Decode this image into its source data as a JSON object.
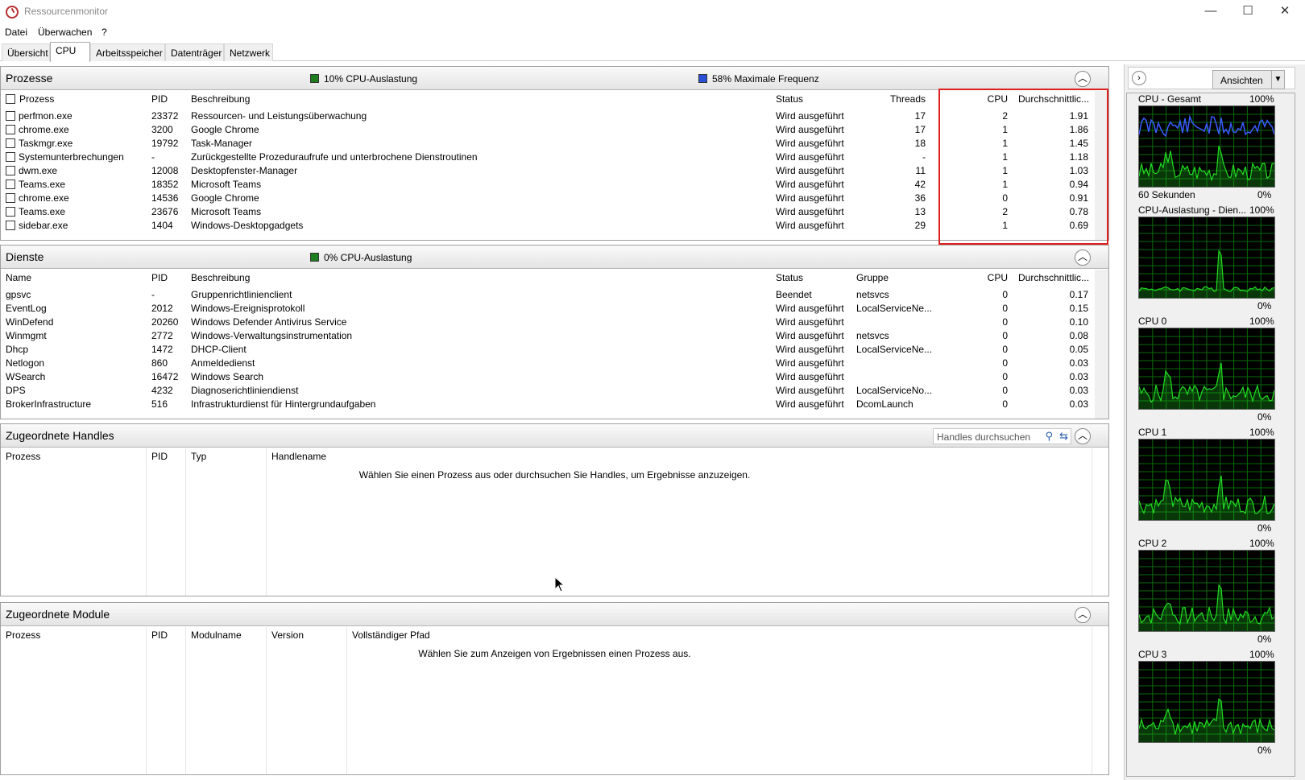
{
  "window": {
    "title": "Ressourcenmonitor",
    "minimize": "—",
    "maximize": "☐",
    "close": "✕"
  },
  "menu": [
    "Datei",
    "Überwachen",
    "?"
  ],
  "tabs": [
    "Übersicht",
    "CPU",
    "Arbeitsspeicher",
    "Datenträger",
    "Netzwerk"
  ],
  "active_tab": "CPU",
  "processes": {
    "title": "Prozesse",
    "cpu_usage": "10% CPU-Auslastung",
    "max_freq": "58% Maximale Frequenz",
    "usage_color": "#1e7d1e",
    "freq_color": "#2a50d8",
    "columns": [
      "Prozess",
      "PID",
      "Beschreibung",
      "Status",
      "Threads",
      "CPU",
      "Durchschnittlic..."
    ],
    "rows": [
      [
        "perfmon.exe",
        "23372",
        "Ressourcen- und Leistungsüberwachung",
        "Wird ausgeführt",
        "17",
        "2",
        "1.91"
      ],
      [
        "chrome.exe",
        "3200",
        "Google Chrome",
        "Wird ausgeführt",
        "17",
        "1",
        "1.86"
      ],
      [
        "Taskmgr.exe",
        "19792",
        "Task-Manager",
        "Wird ausgeführt",
        "18",
        "1",
        "1.45"
      ],
      [
        "Systemunterbrechungen",
        "-",
        "Zurückgestellte Prozeduraufrufe und unterbrochene Dienstroutinen",
        "Wird ausgeführt",
        "-",
        "1",
        "1.18"
      ],
      [
        "dwm.exe",
        "12008",
        "Desktopfenster-Manager",
        "Wird ausgeführt",
        "11",
        "1",
        "1.03"
      ],
      [
        "Teams.exe",
        "18352",
        "Microsoft Teams",
        "Wird ausgeführt",
        "42",
        "1",
        "0.94"
      ],
      [
        "chrome.exe",
        "14536",
        "Google Chrome",
        "Wird ausgeführt",
        "36",
        "0",
        "0.91"
      ],
      [
        "Teams.exe",
        "23676",
        "Microsoft Teams",
        "Wird ausgeführt",
        "13",
        "2",
        "0.78"
      ],
      [
        "sidebar.exe",
        "1404",
        "Windows-Desktopgadgets",
        "Wird ausgeführt",
        "29",
        "1",
        "0.69"
      ]
    ]
  },
  "services": {
    "title": "Dienste",
    "cpu_usage": "0% CPU-Auslastung",
    "columns": [
      "Name",
      "PID",
      "Beschreibung",
      "Status",
      "Gruppe",
      "CPU",
      "Durchschnittlic..."
    ],
    "rows": [
      [
        "gpsvc",
        "-",
        "Gruppenrichtlinienclient",
        "Beendet",
        "netsvcs",
        "0",
        "0.17"
      ],
      [
        "EventLog",
        "2012",
        "Windows-Ereignisprotokoll",
        "Wird ausgeführt",
        "LocalServiceNe...",
        "0",
        "0.15"
      ],
      [
        "WinDefend",
        "20260",
        "Windows Defender Antivirus Service",
        "Wird ausgeführt",
        "",
        "0",
        "0.10"
      ],
      [
        "Winmgmt",
        "2772",
        "Windows-Verwaltungsinstrumentation",
        "Wird ausgeführt",
        "netsvcs",
        "0",
        "0.08"
      ],
      [
        "Dhcp",
        "1472",
        "DHCP-Client",
        "Wird ausgeführt",
        "LocalServiceNe...",
        "0",
        "0.05"
      ],
      [
        "Netlogon",
        "860",
        "Anmeldedienst",
        "Wird ausgeführt",
        "",
        "0",
        "0.03"
      ],
      [
        "WSearch",
        "16472",
        "Windows Search",
        "Wird ausgeführt",
        "",
        "0",
        "0.03"
      ],
      [
        "DPS",
        "4232",
        "Diagnoserichtliniendienst",
        "Wird ausgeführt",
        "LocalServiceNo...",
        "0",
        "0.03"
      ],
      [
        "BrokerInfrastructure",
        "516",
        "Infrastrukturdienst für Hintergrundaufgaben",
        "Wird ausgeführt",
        "DcomLaunch",
        "0",
        "0.03"
      ]
    ]
  },
  "handles": {
    "title": "Zugeordnete Handles",
    "search_placeholder": "Handles durchsuchen",
    "columns": [
      "Prozess",
      "PID",
      "Typ",
      "Handlename"
    ],
    "empty": "Wählen Sie einen Prozess aus oder durchsuchen Sie Handles, um Ergebnisse anzuzeigen."
  },
  "modules": {
    "title": "Zugeordnete Module",
    "columns": [
      "Prozess",
      "PID",
      "Modulname",
      "Version",
      "Vollständiger Pfad"
    ],
    "empty": "Wählen Sie zum Anzeigen von Ergebnissen einen Prozess aus."
  },
  "sidebar": {
    "views_label": "Ansichten",
    "graphs": [
      {
        "name": "CPU - Gesamt",
        "max": "100%",
        "min": "0%",
        "footer": "60 Sekunden"
      },
      {
        "name": "CPU-Auslastung - Dien...",
        "max": "100%",
        "min": "0%"
      },
      {
        "name": "CPU 0",
        "max": "100%",
        "min": "0%"
      },
      {
        "name": "CPU 1",
        "max": "100%",
        "min": "0%"
      },
      {
        "name": "CPU 2",
        "max": "100%",
        "min": "0%"
      },
      {
        "name": "CPU 3",
        "max": "100%",
        "min": "0%"
      }
    ],
    "graph_line_color": "#22dd22",
    "graph_freq_color": "#3a5cff"
  }
}
